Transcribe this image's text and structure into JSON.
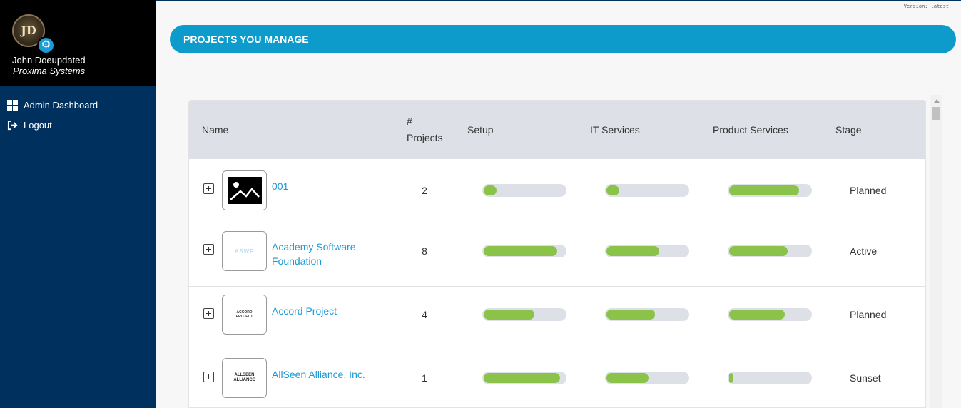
{
  "app": {
    "version": "Version: latest"
  },
  "user": {
    "initials": "JD",
    "name": "John Doeupdated",
    "org": "Proxima Systems"
  },
  "nav": [
    {
      "label": "Admin Dashboard",
      "icon": "dashboard-icon"
    },
    {
      "label": "Logout",
      "icon": "logout-icon"
    }
  ],
  "banner": {
    "title": "PROJECTS YOU MANAGE"
  },
  "table": {
    "headers": {
      "name": "Name",
      "projects_hash": "#",
      "projects": "Projects",
      "setup": "Setup",
      "it": "IT Services",
      "product": "Product Services",
      "stage": "Stage"
    },
    "rows": [
      {
        "name": "001",
        "logo": "image-placeholder-icon",
        "count": "2",
        "setup": 0.16,
        "it": 0.16,
        "product": 0.86,
        "stage": "Planned"
      },
      {
        "name": "Academy Software Foundation",
        "logo_text": "ASWF",
        "count": "8",
        "setup": 0.9,
        "it": 0.65,
        "product": 0.72,
        "stage": "Active"
      },
      {
        "name": "Accord Project",
        "logo_text": "ACCORD PROJECT",
        "count": "4",
        "setup": 0.62,
        "it": 0.6,
        "product": 0.68,
        "stage": "Planned"
      },
      {
        "name": "AllSeen Alliance, Inc.",
        "logo_text": "ALLSEEN ALLIANCE",
        "count": "1",
        "setup": 0.94,
        "it": 0.52,
        "product": 0.04,
        "stage": "Sunset"
      }
    ]
  },
  "colors": {
    "sidebar": "#00305e",
    "banner": "#0d9bcc",
    "link": "#1a9ad6",
    "bar_fill": "#8bc34a",
    "bar_track": "#dde1e7"
  }
}
